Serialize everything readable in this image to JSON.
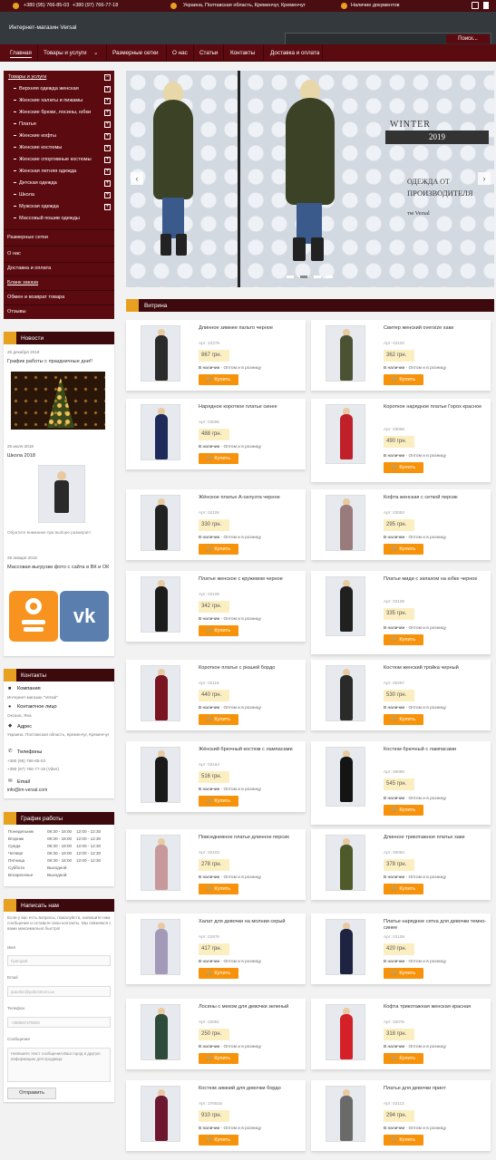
{
  "topbar": {
    "phone1": "+380 (95) 766-85-03",
    "phone2": "+380 (97) 766-77-18",
    "address": "Украина, Полтавская область, Кременчуг, Кременчуг",
    "docs": "Наличие документов"
  },
  "header": {
    "site_title": "Интернет-магазин Versal",
    "search_button": "Поиск..."
  },
  "nav": {
    "items": [
      "Главная",
      "Товары и услуги",
      "Размерные сетки",
      "О нас",
      "Статьи",
      "Контакты",
      "Доставка и оплата"
    ]
  },
  "sidebar": {
    "catalog_title": "Товары и услуги",
    "categories": [
      "Верхняя одежда женская",
      "Женские халаты и пижамы",
      "Женские брюки, лосины, юбки",
      "Платья",
      "Женские кофты",
      "Женские костюмы",
      "Женские спортивные костюмы",
      "Женская летняя одежда",
      "Детская одежда",
      "Школа",
      "Мужская одежда",
      "Массовый пошив одежды"
    ],
    "links": [
      "Размерные сетки",
      "О нас",
      "Доставка и оплата",
      "Бланк заказа",
      "Обмен и возврат товара",
      "Отзывы"
    ]
  },
  "news": {
    "title": "Новости",
    "items": [
      {
        "date": "26 декабря 2018",
        "text": "График работы с праздничные дни!!"
      },
      {
        "date": "25 июля 2018",
        "text": "Школа 2018",
        "note": "Обратите внимание при выборе размера!!!"
      },
      {
        "date": "29 января 2018",
        "text": "Массовая выгрузки фото с сайта в ВК и ОК"
      }
    ]
  },
  "contacts": {
    "title": "Контакты",
    "company_label": "Компания",
    "company": "Интернет-магазин \"Versal\"",
    "person_label": "Контактное лицо",
    "person": "Оксана, Яна",
    "address_label": "Адрес",
    "address": "Украина, Полтавская область, Кременчуг, Кременчуг",
    "phones_label": "Телефоны",
    "phone1": "+380 (95) 766-85-03",
    "phone2": "+380 (97) 766-77-18 (Viber)",
    "email_label": "Email",
    "email": "info@im-versal.com"
  },
  "schedule": {
    "title": "График работы",
    "rows": [
      [
        "Понедельник",
        "09:30 - 18:00",
        "12:00 - 12:30"
      ],
      [
        "Вторник",
        "09:30 - 18:00",
        "12:00 - 12:30"
      ],
      [
        "Среда",
        "09:30 - 18:00",
        "12:00 - 12:30"
      ],
      [
        "Четверг",
        "09:30 - 18:00",
        "12:00 - 12:30"
      ],
      [
        "Пятница",
        "09:30 - 18:00",
        "12:00 - 12:30"
      ],
      [
        "Суббота",
        "Выходной",
        ""
      ],
      [
        "Воскресенье",
        "Выходной",
        ""
      ]
    ]
  },
  "write_us": {
    "title": "Написать нам",
    "intro": "Если у вас есть вопросы, пожалуйста, напишите нам сообщение и оставьте свои контакты. Мы свяжемся с вами максимально быстро!",
    "name_label": "Имя",
    "name_placeholder": "Григорий",
    "email_label": "Email",
    "email_placeholder": "gutorkin@polezntrum.ua",
    "phone_label": "Телефон",
    "phone_placeholder": "+380667475003",
    "message_label": "Сообщение",
    "message_placeholder": "Напишите текст сообщения.Ваш город и другую информацию для продавца",
    "submit": "Отправить"
  },
  "hero": {
    "line1": "WINTER",
    "year": "2019",
    "line2": "ОДЕЖДА ОТ",
    "line3": "ПРОИЗВОДИТЕЛЯ",
    "brand": "тм Versal"
  },
  "showcase": {
    "title": "Витрина",
    "in_stock": "В наличии",
    "wholesale": "Оптом и в розницу",
    "buy": "Купить",
    "products": [
      {
        "title": "Длинное зимнее пальто черное",
        "art": "Арт: 22379",
        "price": "867 грн.",
        "color": "#2b2b2b"
      },
      {
        "title": "Свитер женский oversize хаки",
        "art": "Арт: 02102",
        "price": "362 грн.",
        "color": "#4b5233"
      },
      {
        "title": "Нарядное короткое платье синее",
        "art": "Арт: 03095",
        "price": "488 грн.",
        "color": "#1e2b5a"
      },
      {
        "title": "Короткое нарядное платье Горох красное",
        "art": "Арт: 03098",
        "price": "490 грн.",
        "color": "#c0202a"
      },
      {
        "title": "Жёнское платье А-силуэта черное",
        "art": "Арт: 02106",
        "price": "330 грн.",
        "color": "#222"
      },
      {
        "title": "Кофта женская с сеткой персик",
        "art": "Арт: 03093",
        "price": "295 грн.",
        "color": "#9a7b7b"
      },
      {
        "title": "Платье женское с кружевом черное",
        "art": "Арт: 02105",
        "price": "342 грн.",
        "color": "#1c1c1c"
      },
      {
        "title": "Платье миди с запахом на юбке черное",
        "art": "Арт: 02108",
        "price": "335 грн.",
        "color": "#202020"
      },
      {
        "title": "Короткое платье с рюшей бордо",
        "art": "Арт: 02119",
        "price": "440 грн.",
        "color": "#7a1420"
      },
      {
        "title": "Костюм женский тройка черный",
        "art": "Арт: 00297",
        "price": "530 грн.",
        "color": "#2a2a2a"
      },
      {
        "title": "Жёнский брючный костюм с лампасами",
        "art": "Арт: 02164",
        "price": "516 грн.",
        "color": "#1a1a1a"
      },
      {
        "title": "Костюм брючный с лампасами",
        "art": "Арт: 00096",
        "price": "545 грн.",
        "color": "#141414"
      },
      {
        "title": "Повседневное платье длинное персик",
        "art": "Арт: 02103",
        "price": "278 грн.",
        "color": "#c7999b"
      },
      {
        "title": "Длинное трикотажное платье хаки",
        "art": "Арт: 00094",
        "price": "378 грн.",
        "color": "#4f5a2a"
      },
      {
        "title": "Халат для девочки на молнии серый",
        "art": "Арт: 02976",
        "price": "417 грн.",
        "color": "#a29ab8"
      },
      {
        "title": "Платье нарядное сетка для девочки темно-синее",
        "art": "Арт: 02109",
        "price": "420 грн.",
        "color": "#1d2340"
      },
      {
        "title": "Лосины с мехом для девочки зеленый",
        "art": "Арт: 02081",
        "price": "250 грн.",
        "color": "#2e4a3a"
      },
      {
        "title": "Кофта трикотажная женская красная",
        "art": "Арт: 02075",
        "price": "318 грн.",
        "color": "#d42028"
      },
      {
        "title": "Костюм зимний для девочки бордо",
        "art": "Арт: 37651Б",
        "price": "910 грн.",
        "color": "#6e1830"
      },
      {
        "title": "Платье для девочки принт",
        "art": "Арт: 02113",
        "price": "294 грн.",
        "color": "#6a6a6a"
      }
    ]
  }
}
